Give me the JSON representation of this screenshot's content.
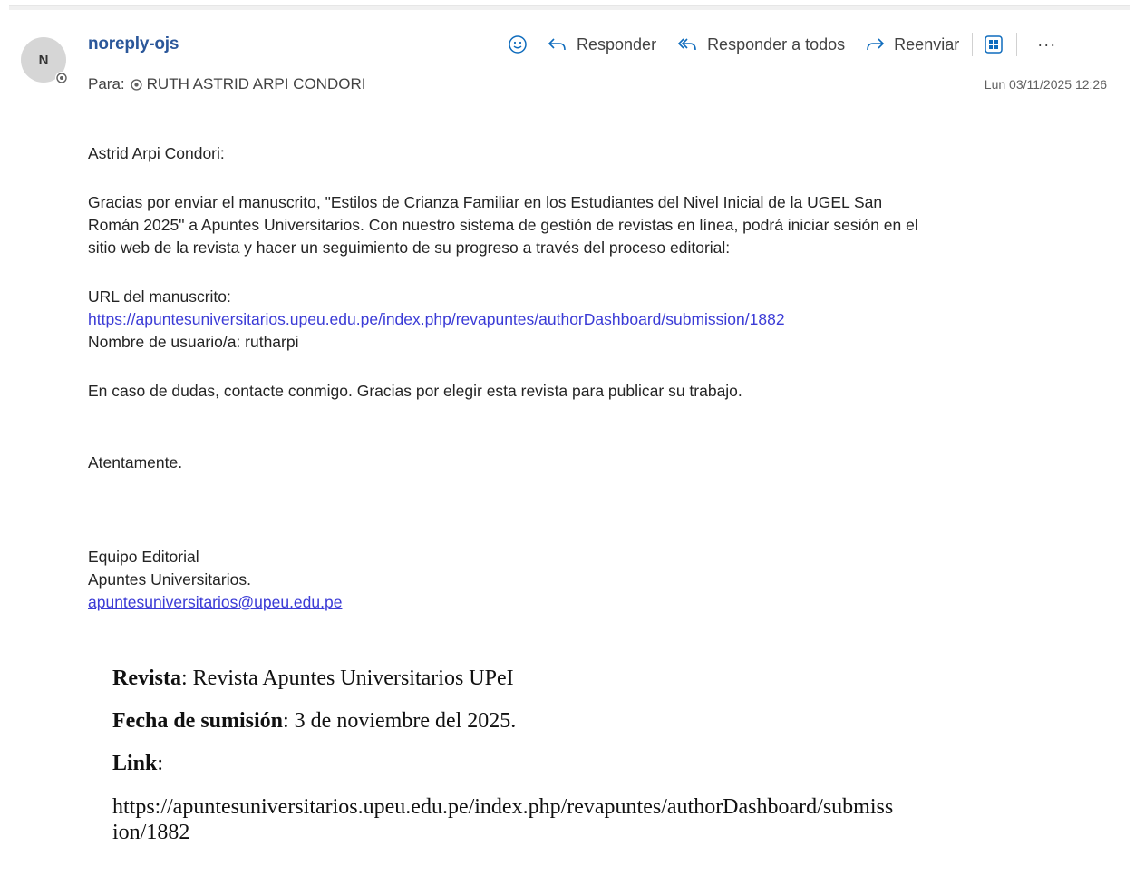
{
  "header": {
    "avatar_initial": "N",
    "sender": "noreply-ojs",
    "to_label": "Para:",
    "recipient": "RUTH ASTRID ARPI CONDORI",
    "date": "Lun 03/11/2025 12:26"
  },
  "actions": {
    "reply": "Responder",
    "reply_all": "Responder a todos",
    "forward": "Reenviar",
    "more": "···"
  },
  "body": {
    "greeting": "Astrid Arpi Condori:",
    "paragraph1_line1": "Gracias por enviar el manuscrito, \"Estilos de Crianza Familiar en los Estudiantes del Nivel Inicial de la UGEL San",
    "paragraph1_line2": "Román 2025\" a Apuntes Universitarios. Con nuestro sistema de gestión de revistas en línea, podrá iniciar sesión en el",
    "paragraph1_line3": "sitio web de la revista y hacer un seguimiento de su progreso a través del proceso editorial:",
    "url_label": "URL del manuscrito:",
    "url": "https://apuntesuniversitarios.upeu.edu.pe/index.php/revapuntes/authorDashboard/submission/1882",
    "username": "Nombre de usuario/a: rutharpi",
    "closing_note": "En caso de dudas, contacte conmigo. Gracias por elegir esta revista para publicar su trabajo.",
    "regards": "Atentamente.",
    "sig_team": "Equipo Editorial",
    "sig_journal": "Apuntes Universitarios.",
    "sig_email": "apuntesuniversitarios@upeu.edu.pe"
  },
  "appendix": {
    "journal_label": "Revista",
    "journal_value": ": Revista Apuntes Universitarios UPeI",
    "date_label": "Fecha de sumisión",
    "date_value": ": 3 de noviembre del 2025.",
    "link_label": "Link",
    "link_colon": ":",
    "link_line1": "https://apuntesuniversitarios.upeu.edu.pe/index.php/revapuntes/authorDashboard/submiss",
    "link_line2": "ion/1882"
  },
  "colors": {
    "sender": "#2b579a",
    "link": "#3b3bd6",
    "accent": "#0f6cbd"
  },
  "icons": {
    "emoji": "emoji-icon",
    "reply": "reply-icon",
    "reply_all": "reply-all-icon",
    "forward": "forward-icon",
    "apps": "apps-icon",
    "presence": "presence-blocked-icon"
  }
}
